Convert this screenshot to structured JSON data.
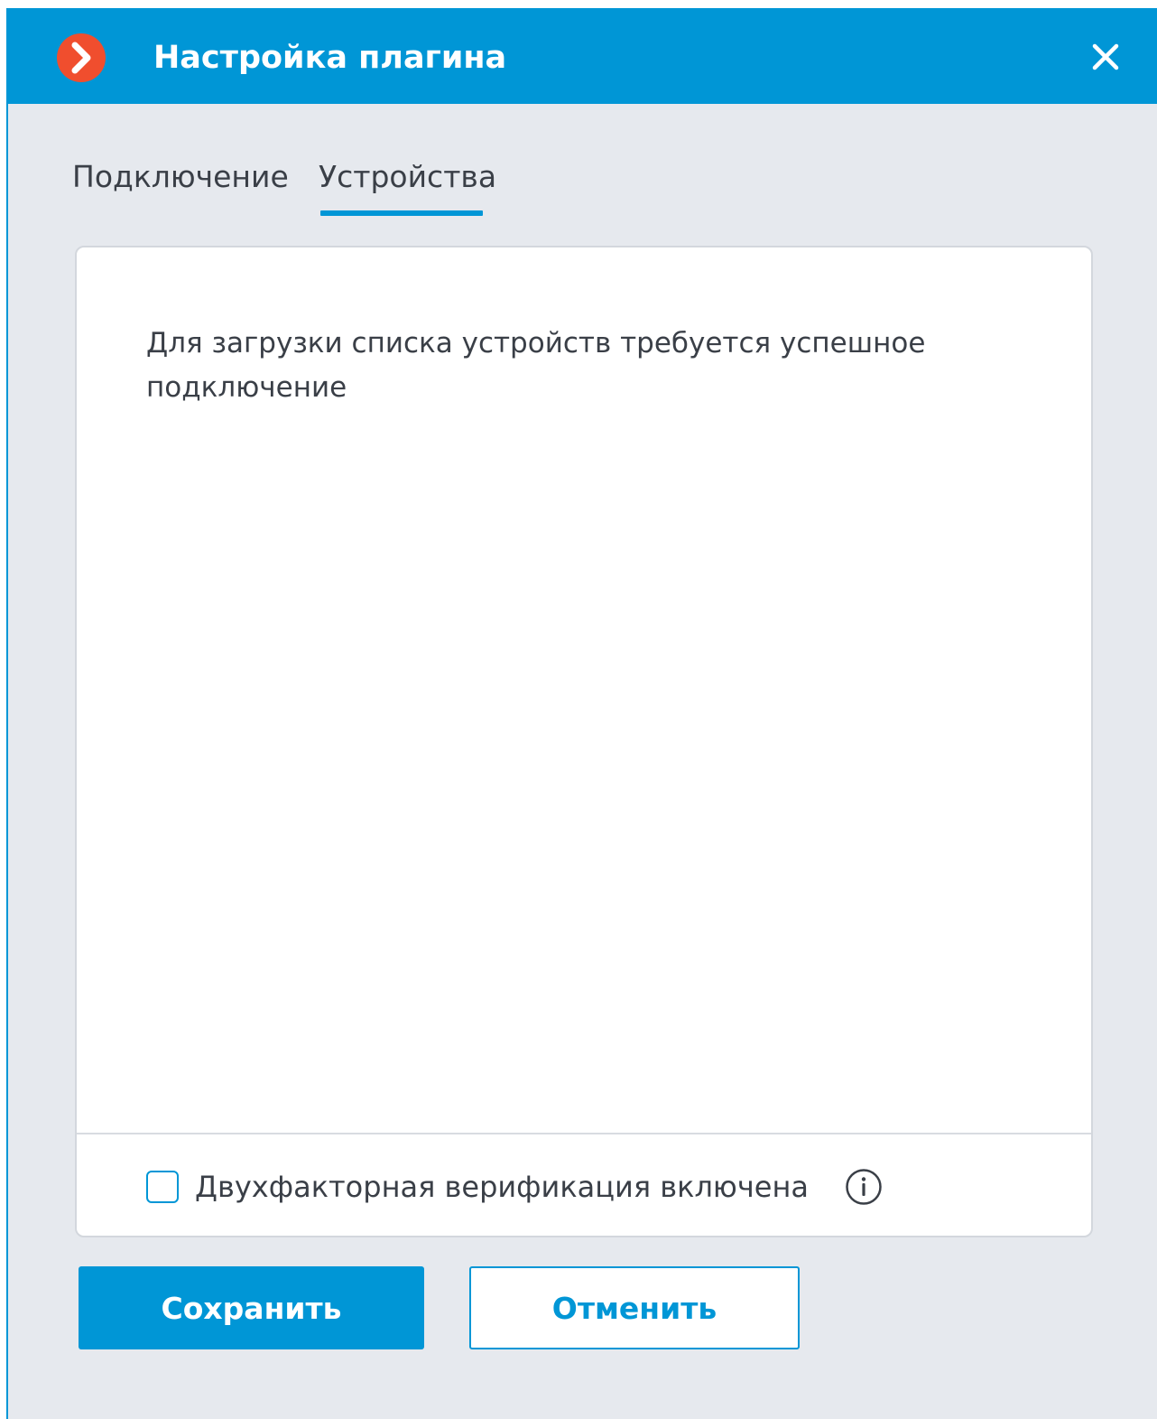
{
  "window": {
    "title": "Настройка плагина",
    "logo_icon": "app-logo-arrow-icon",
    "close_icon": "close-icon",
    "accent_color": "#0096d6",
    "logo_color": "#f04e2e"
  },
  "tabs": [
    {
      "label": "Подключение",
      "active": false
    },
    {
      "label": "Устройства",
      "active": true
    }
  ],
  "panel": {
    "message": "Для загрузки списка устройств требуется успешное подключение",
    "two_factor": {
      "label": "Двухфакторная верификация включена",
      "checked": false,
      "info_icon": "info-icon"
    }
  },
  "buttons": {
    "save_label": "Сохранить",
    "cancel_label": "Отменить"
  }
}
